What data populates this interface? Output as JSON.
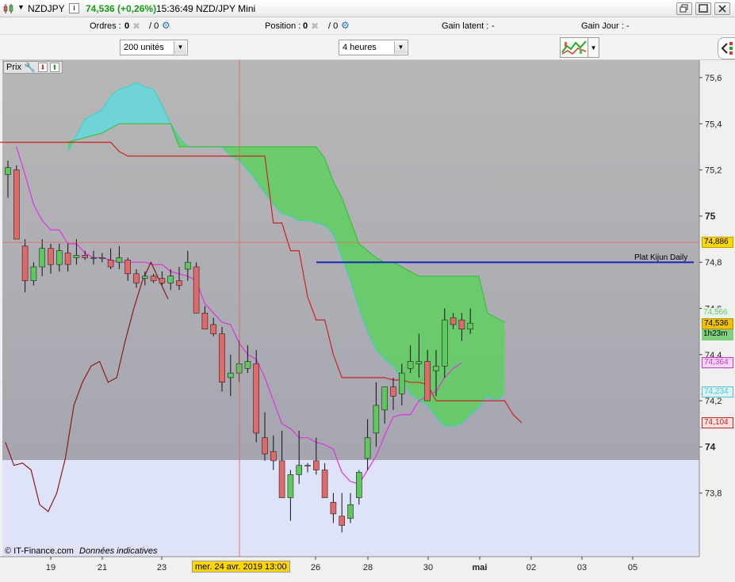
{
  "title_bar": {
    "symbol": "NZDJPY",
    "price_change": "74,536 (+0,26%)",
    "time_title": "15:36:49 NZD/JPY Mini"
  },
  "info_bar": {
    "orders_label": "Ordres :",
    "orders_value": "0",
    "orders_pending": "/ 0",
    "position_label": "Position :",
    "position_value": "0",
    "position_pending": "/ 0",
    "latent_label": "Gain latent :",
    "latent_value": "-",
    "day_label": "Gain Jour :",
    "day_value": "-"
  },
  "toolbar": {
    "quantity": "200 unités",
    "period": "4 heures"
  },
  "chart_header": {
    "label": "Prix"
  },
  "footer": {
    "copyright": "© IT-Finance.com",
    "note": "Données indicatives"
  },
  "cursor_label": "mer. 24 avr. 2019 13:00",
  "hline_label": "Plat Kijun Daily",
  "price_tags": {
    "cursor": "74,886",
    "current": "74,536",
    "timer": "1h23m",
    "cloud_a": "74,566",
    "tenkan": "74,364",
    "cloud_b": "74,234",
    "kijun": "74,104"
  },
  "colors": {
    "up_candle": "#5ec85e",
    "down_candle": "#e06a6a",
    "cloud": "#5fcf5f",
    "cloud_bear": "#6fd3d8",
    "tenkan": "#dd33dd",
    "kijun": "#cc2222",
    "chikou": "#8b1a1a",
    "hline": "#1a2ab8"
  },
  "chart_data": {
    "type": "candlestick",
    "instrument": "NZDJPY",
    "timeframe": "4 heures",
    "ylim": [
      73.55,
      75.67
    ],
    "y_ticks": [
      "75,6",
      "75,4",
      "75,2",
      "75",
      "74,8",
      "74,6",
      "74,4",
      "74,2",
      "74",
      "73,8"
    ],
    "x_ticks": [
      "19",
      "21",
      "23",
      "26",
      "28",
      "30",
      "mai",
      "02",
      "03",
      "05"
    ],
    "candles": [
      {
        "o": 75.18,
        "h": 75.24,
        "l": 75.08,
        "c": 75.21
      },
      {
        "o": 75.2,
        "h": 75.22,
        "l": 74.94,
        "c": 74.9
      },
      {
        "o": 74.87,
        "h": 74.9,
        "l": 74.67,
        "c": 74.72
      },
      {
        "o": 74.72,
        "h": 74.8,
        "l": 74.7,
        "c": 74.78
      },
      {
        "o": 74.78,
        "h": 74.9,
        "l": 74.74,
        "c": 74.86
      },
      {
        "o": 74.86,
        "h": 74.88,
        "l": 74.75,
        "c": 74.79
      },
      {
        "o": 74.79,
        "h": 74.88,
        "l": 74.76,
        "c": 74.85
      },
      {
        "o": 74.84,
        "h": 74.88,
        "l": 74.76,
        "c": 74.79
      },
      {
        "o": 74.82,
        "h": 74.9,
        "l": 74.79,
        "c": 74.83
      },
      {
        "o": 74.83,
        "h": 74.85,
        "l": 74.81,
        "c": 74.82
      },
      {
        "o": 74.82,
        "h": 74.85,
        "l": 74.79,
        "c": 74.82
      },
      {
        "o": 74.82,
        "h": 74.84,
        "l": 74.8,
        "c": 74.82
      },
      {
        "o": 74.81,
        "h": 74.86,
        "l": 74.77,
        "c": 74.78
      },
      {
        "o": 74.8,
        "h": 74.87,
        "l": 74.77,
        "c": 74.82
      },
      {
        "o": 74.81,
        "h": 74.82,
        "l": 74.72,
        "c": 74.75
      },
      {
        "o": 74.75,
        "h": 74.77,
        "l": 74.69,
        "c": 74.71
      },
      {
        "o": 74.73,
        "h": 74.76,
        "l": 74.7,
        "c": 74.74
      },
      {
        "o": 74.74,
        "h": 74.75,
        "l": 74.71,
        "c": 74.72
      },
      {
        "o": 74.73,
        "h": 74.76,
        "l": 74.7,
        "c": 74.71
      },
      {
        "o": 74.71,
        "h": 74.77,
        "l": 74.68,
        "c": 74.74
      },
      {
        "o": 74.72,
        "h": 74.78,
        "l": 74.68,
        "c": 74.7
      },
      {
        "o": 74.77,
        "h": 74.85,
        "l": 74.72,
        "c": 74.8
      },
      {
        "o": 74.78,
        "h": 74.8,
        "l": 74.58,
        "c": 74.58
      },
      {
        "o": 74.58,
        "h": 74.61,
        "l": 74.51,
        "c": 74.51
      },
      {
        "o": 74.53,
        "h": 74.56,
        "l": 74.48,
        "c": 74.49
      },
      {
        "o": 74.49,
        "h": 74.52,
        "l": 74.24,
        "c": 74.28
      },
      {
        "o": 74.3,
        "h": 74.4,
        "l": 74.22,
        "c": 74.32
      },
      {
        "o": 74.32,
        "h": 74.46,
        "l": 74.28,
        "c": 74.36
      },
      {
        "o": 74.34,
        "h": 74.44,
        "l": 74.32,
        "c": 74.37
      },
      {
        "o": 74.36,
        "h": 74.42,
        "l": 74.02,
        "c": 74.06
      },
      {
        "o": 74.04,
        "h": 74.15,
        "l": 73.94,
        "c": 73.97
      },
      {
        "o": 73.98,
        "h": 74.05,
        "l": 73.9,
        "c": 73.94
      },
      {
        "o": 73.94,
        "h": 74.07,
        "l": 73.85,
        "c": 73.78
      },
      {
        "o": 73.78,
        "h": 73.9,
        "l": 73.68,
        "c": 73.88
      },
      {
        "o": 73.88,
        "h": 74.07,
        "l": 73.84,
        "c": 73.92
      },
      {
        "o": 73.92,
        "h": 73.93,
        "l": 73.89,
        "c": 73.92
      },
      {
        "o": 73.94,
        "h": 74.04,
        "l": 73.88,
        "c": 73.9
      },
      {
        "o": 73.9,
        "h": 73.93,
        "l": 73.8,
        "c": 73.78
      },
      {
        "o": 73.76,
        "h": 73.8,
        "l": 73.67,
        "c": 73.71
      },
      {
        "o": 73.7,
        "h": 73.8,
        "l": 73.63,
        "c": 73.66
      },
      {
        "o": 73.69,
        "h": 73.8,
        "l": 73.67,
        "c": 73.75
      },
      {
        "o": 73.78,
        "h": 73.9,
        "l": 73.75,
        "c": 73.89
      },
      {
        "o": 73.95,
        "h": 74.12,
        "l": 73.9,
        "c": 74.04
      },
      {
        "o": 74.06,
        "h": 74.28,
        "l": 74.0,
        "c": 74.18
      },
      {
        "o": 74.16,
        "h": 74.26,
        "l": 74.1,
        "c": 74.26
      },
      {
        "o": 74.26,
        "h": 74.3,
        "l": 74.16,
        "c": 74.22
      },
      {
        "o": 74.23,
        "h": 74.36,
        "l": 74.18,
        "c": 74.32
      },
      {
        "o": 74.34,
        "h": 74.44,
        "l": 74.32,
        "c": 74.37
      },
      {
        "o": 74.36,
        "h": 74.49,
        "l": 74.3,
        "c": 74.37
      },
      {
        "o": 74.37,
        "h": 74.42,
        "l": 74.25,
        "c": 74.2
      },
      {
        "o": 74.33,
        "h": 74.42,
        "l": 74.22,
        "c": 74.35
      },
      {
        "o": 74.35,
        "h": 74.6,
        "l": 74.3,
        "c": 74.55
      },
      {
        "o": 74.56,
        "h": 74.58,
        "l": 74.51,
        "c": 74.53
      },
      {
        "o": 74.55,
        "h": 74.58,
        "l": 74.46,
        "c": 74.51
      },
      {
        "o": 74.51,
        "h": 74.6,
        "l": 74.49,
        "c": 74.536
      }
    ],
    "tenkan": [
      75.3,
      75.18,
      75.05,
      74.98,
      74.94,
      74.94,
      74.88,
      74.88,
      74.84,
      74.82,
      74.82,
      74.81,
      74.8,
      74.8,
      74.8,
      74.8,
      74.79,
      74.79,
      74.76,
      74.75,
      74.74,
      74.72,
      74.62,
      74.58,
      74.54,
      74.53,
      74.45,
      74.4,
      74.38,
      74.3,
      74.2,
      74.1,
      74.08,
      74.04,
      74.04,
      74.02,
      74.01,
      73.99,
      73.89,
      73.85,
      73.84,
      73.9,
      73.96,
      74.05,
      74.13,
      74.14,
      74.14,
      74.2,
      74.22,
      74.24,
      74.3,
      74.34,
      74.364
    ],
    "kijun": [
      75.32,
      75.32,
      75.32,
      75.32,
      75.32,
      75.32,
      75.32,
      75.32,
      75.32,
      75.32,
      75.32,
      75.32,
      75.32,
      75.32,
      75.28,
      75.26,
      75.26,
      75.26,
      75.26,
      75.26,
      75.26,
      75.26,
      75.26,
      75.26,
      75.26,
      75.26,
      75.26,
      75.26,
      75.26,
      75.26,
      75.26,
      75.26,
      74.97,
      74.97,
      74.85,
      74.85,
      74.65,
      74.55,
      74.55,
      74.4,
      74.3,
      74.3,
      74.3,
      74.3,
      74.3,
      74.3,
      74.29,
      74.29,
      74.28,
      74.28,
      74.27,
      74.2,
      74.2,
      74.2,
      74.2,
      74.2,
      74.2,
      74.2,
      74.2,
      74.2,
      74.14,
      74.104
    ],
    "cloud_span_a": [
      75.28,
      75.35,
      75.42,
      75.44,
      75.46,
      75.52,
      75.55,
      75.56,
      75.58,
      75.56,
      75.55,
      75.48,
      75.4,
      75.34,
      75.3,
      75.3,
      75.3,
      75.3,
      75.3,
      75.26,
      75.24,
      75.2,
      75.15,
      75.1,
      75.05,
      75.01,
      75.0,
      74.98,
      74.98,
      74.97,
      74.96,
      74.92,
      74.82,
      74.72,
      74.6,
      74.5,
      74.42,
      74.38,
      74.35,
      74.29,
      74.23,
      74.2,
      74.18,
      74.13,
      74.09,
      74.09,
      74.1,
      74.14,
      74.17,
      74.22,
      74.2,
      74.23
    ],
    "cloud_span_b": [
      75.32,
      75.33,
      75.34,
      75.35,
      75.36,
      75.38,
      75.4,
      75.4,
      75.4,
      75.4,
      75.4,
      75.4,
      75.4,
      75.3,
      75.3,
      75.3,
      75.3,
      75.3,
      75.3,
      75.3,
      75.3,
      75.3,
      75.3,
      75.3,
      75.3,
      75.3,
      75.3,
      75.3,
      75.3,
      75.3,
      75.25,
      75.15,
      75.08,
      74.98,
      74.88,
      74.85,
      74.82,
      74.8,
      74.8,
      74.78,
      74.76,
      74.74,
      74.74,
      74.74,
      74.74,
      74.74,
      74.74,
      74.74,
      74.74,
      74.58,
      74.56,
      74.54
    ],
    "chikou": [
      74.02,
      73.92,
      73.93,
      73.9,
      73.75,
      73.72,
      73.8,
      73.95,
      74.18,
      74.28,
      74.35,
      74.37,
      74.28,
      74.3,
      74.46,
      74.6,
      74.72,
      74.8,
      74.72,
      74.64
    ],
    "hline": {
      "value": 74.8,
      "label": "Plat Kijun Daily"
    },
    "cursor_price": 74.886
  }
}
